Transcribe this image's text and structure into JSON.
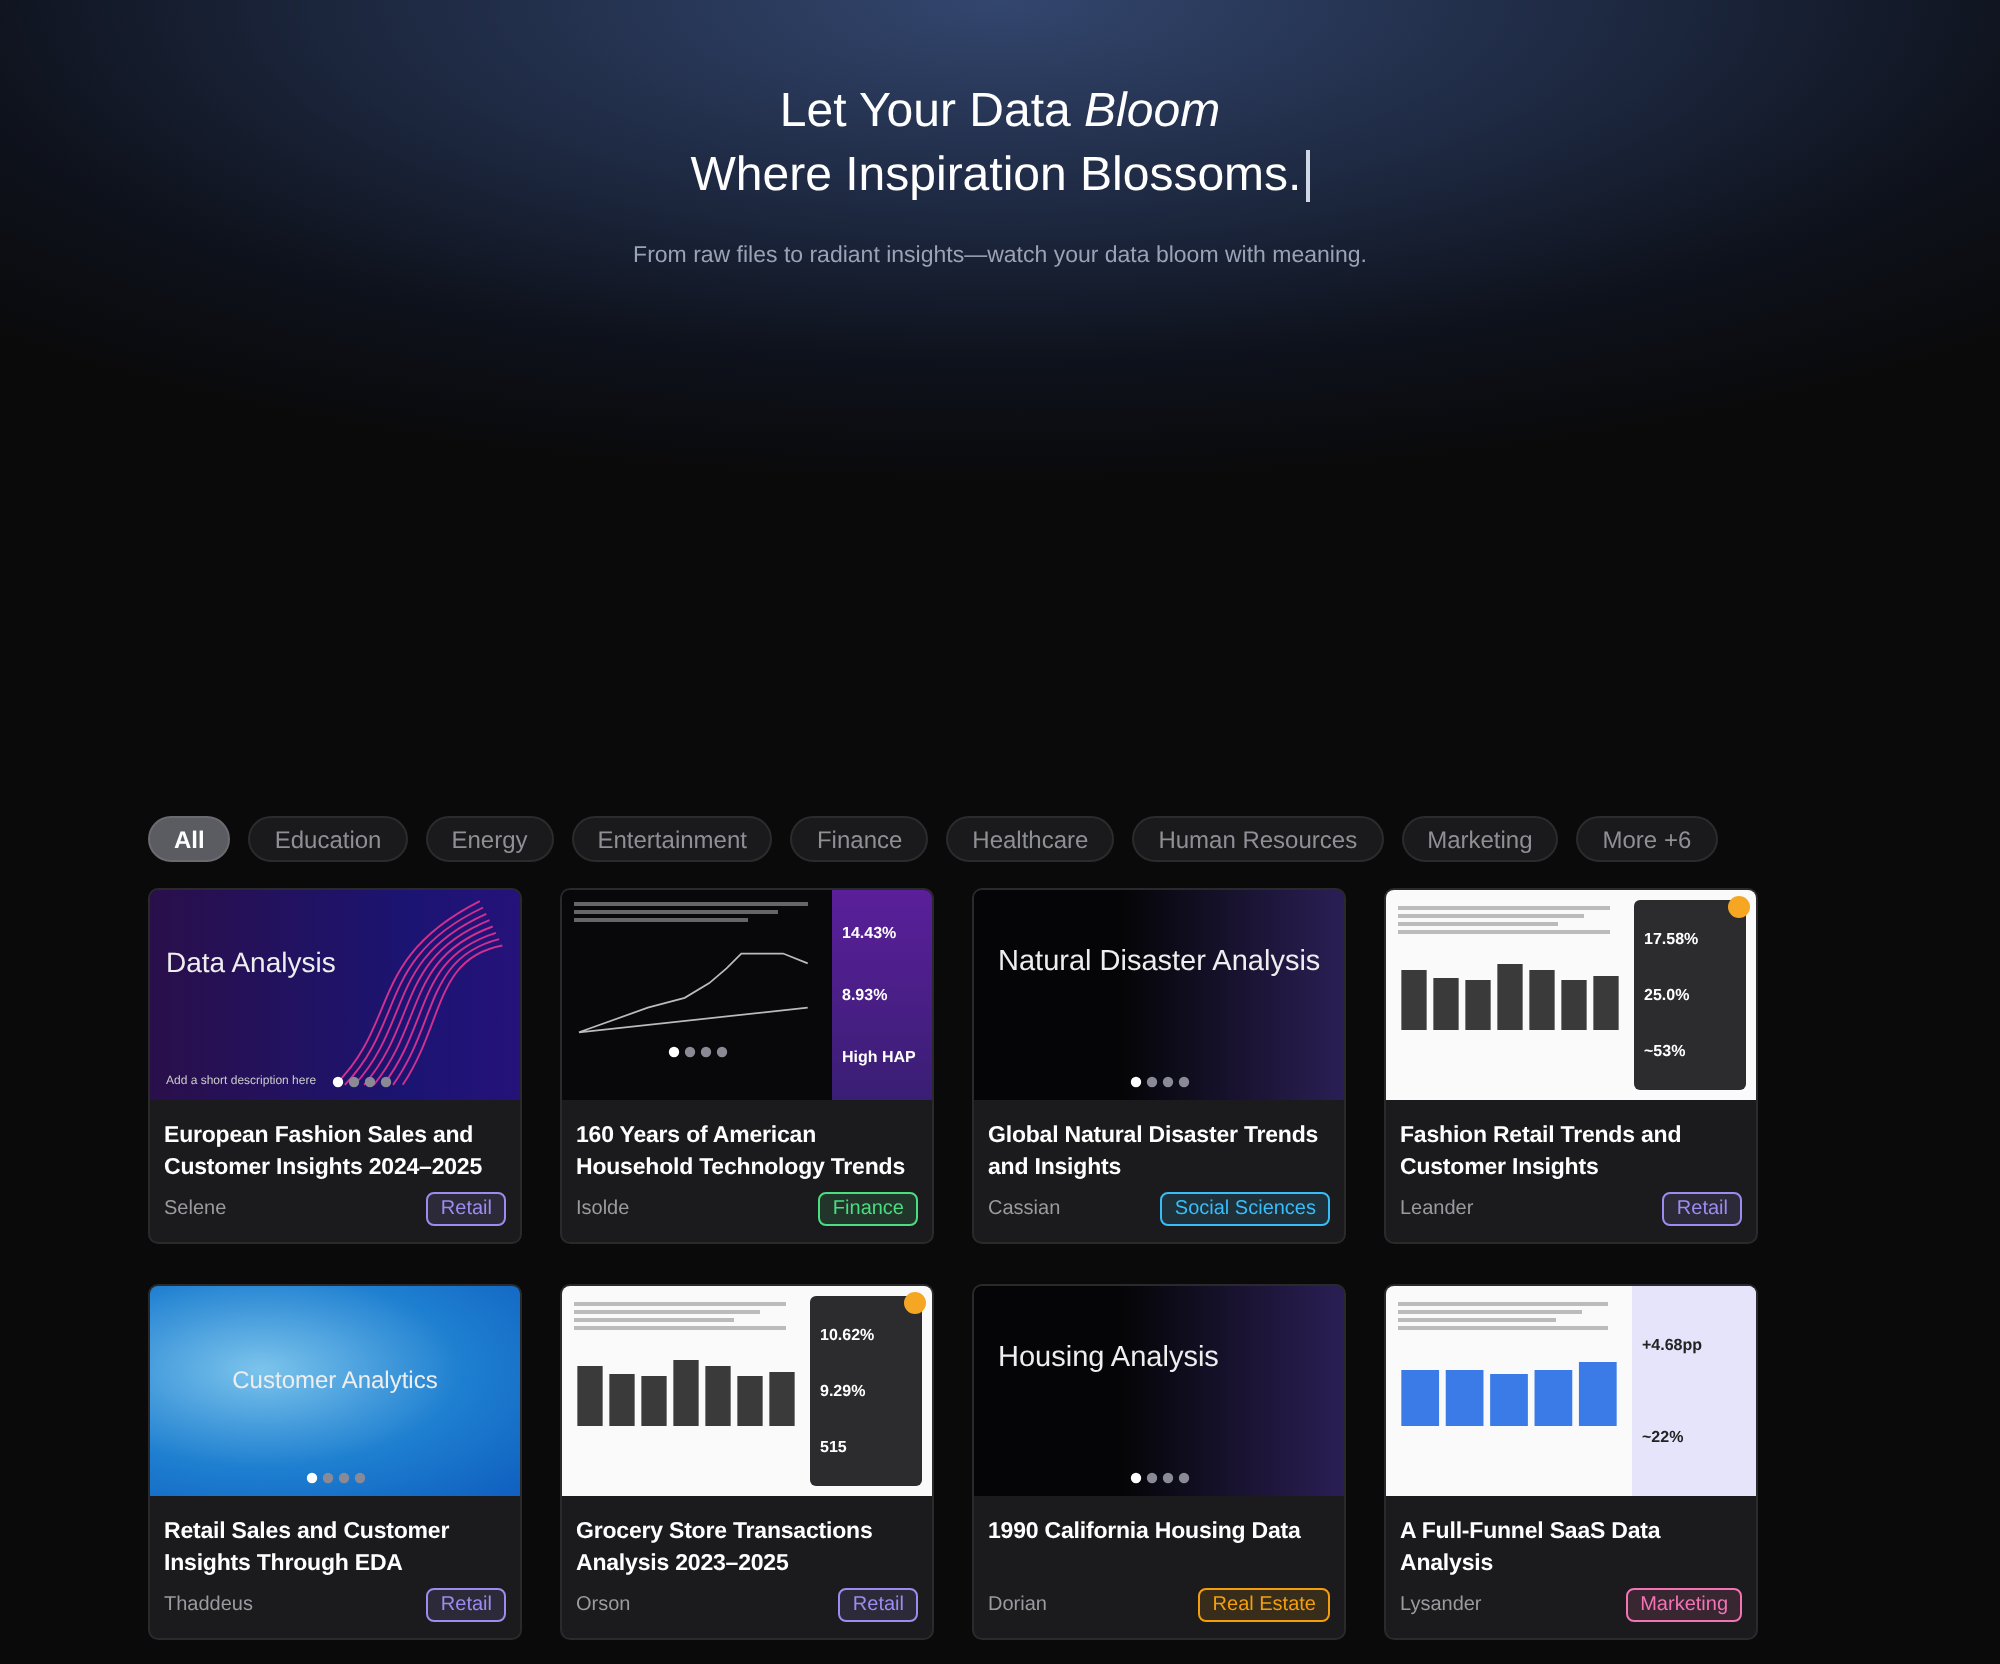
{
  "hero": {
    "headline_line_1": "Let Your Data *Bloom*",
    "headline_line_2": "Where Inspiration Blossoms.",
    "subtitle": "From raw files to radiant insights—watch your data bloom with meaning."
  },
  "filters": [
    {
      "label": "All",
      "selected": true
    },
    {
      "label": "Education",
      "selected": false
    },
    {
      "label": "Energy",
      "selected": false
    },
    {
      "label": "Entertainment",
      "selected": false
    },
    {
      "label": "Finance",
      "selected": false
    },
    {
      "label": "Healthcare",
      "selected": false
    },
    {
      "label": "Human Resources",
      "selected": false
    },
    {
      "label": "Marketing",
      "selected": false
    },
    {
      "label": "More +6",
      "selected": false
    }
  ],
  "cards": [
    {
      "title": "European Fashion Sales and Customer Insights 2024–2025",
      "author": "Selene",
      "tag": "Retail",
      "color": "#9d8cf0",
      "thumbnail": {
        "kind": "wave",
        "title": "Data Analysis",
        "caption": "Add a short description here"
      }
    },
    {
      "title": "160 Years of American Household Technology Trends",
      "author": "Isolde",
      "tag": "Finance",
      "color": "#4ade80",
      "thumbnail": {
        "kind": "dark-chart",
        "stats": [
          "14.43%",
          "8.93%",
          "High HAP"
        ]
      }
    },
    {
      "title": "Global Natural Disaster Trends and Insights",
      "author": "Cassian",
      "tag": "Social Sciences",
      "color": "#38bdf8",
      "thumbnail": {
        "kind": "gradient",
        "title": "Natural Disaster  Analysis"
      }
    },
    {
      "title": "Fashion Retail Trends and Customer Insights",
      "author": "Leander",
      "tag": "Retail",
      "color": "#9d8cf0",
      "thumbnail": {
        "kind": "report",
        "stats": [
          "17.58%",
          "25.0%",
          "~53%"
        ]
      }
    },
    {
      "title": "Retail Sales and Customer Insights Through EDA",
      "author": "Thaddeus",
      "tag": "Retail",
      "color": "#9d8cf0",
      "thumbnail": {
        "kind": "blue",
        "title": "Customer Analytics"
      }
    },
    {
      "title": "Grocery Store Transactions Analysis 2023–2025",
      "author": "Orson",
      "tag": "Retail",
      "color": "#9d8cf0",
      "thumbnail": {
        "kind": "report",
        "stats": [
          "10.62%",
          "9.29%",
          "515"
        ]
      }
    },
    {
      "title": "1990 California Housing Data",
      "author": "Dorian",
      "tag": "Real Estate",
      "color": "#f59e0b",
      "thumbnail": {
        "kind": "gradient",
        "title": "Housing Analysis"
      }
    },
    {
      "title": "A Full-Funnel SaaS Data Analysis",
      "author": "Lysander",
      "tag": "Marketing",
      "color": "#f472b6",
      "thumbnail": {
        "kind": "light-bars",
        "stats": [
          "+4.68pp",
          "~22%"
        ]
      }
    }
  ]
}
